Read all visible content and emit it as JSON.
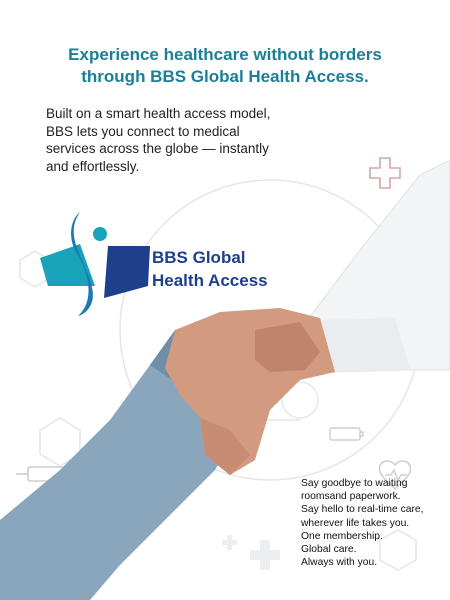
{
  "headline": {
    "line1": "Experience healthcare without borders",
    "line2": "through BBS Global Health Access."
  },
  "intro": {
    "line1": "Built on a smart health access model,",
    "line2": "BBS lets you connect to medical",
    "line3": "services across the globe — instantly",
    "line4": "and effortlessly."
  },
  "logo": {
    "line1": "BBS Global",
    "line2": "Health Access"
  },
  "closing": {
    "line1": "Say goodbye to waiting",
    "line2": "roomsand paperwork.",
    "line3": "Say hello to real-time care,",
    "line4": "wherever life takes you.",
    "line5": "One membership.",
    "line6": "Global care.",
    "line7": "Always with you."
  },
  "colors": {
    "headline": "#1a7f97",
    "logo_blue": "#1d3f8c",
    "logo_teal": "#18a3b8",
    "glove": "#8aa6bd",
    "skin": "#d29a7e"
  }
}
